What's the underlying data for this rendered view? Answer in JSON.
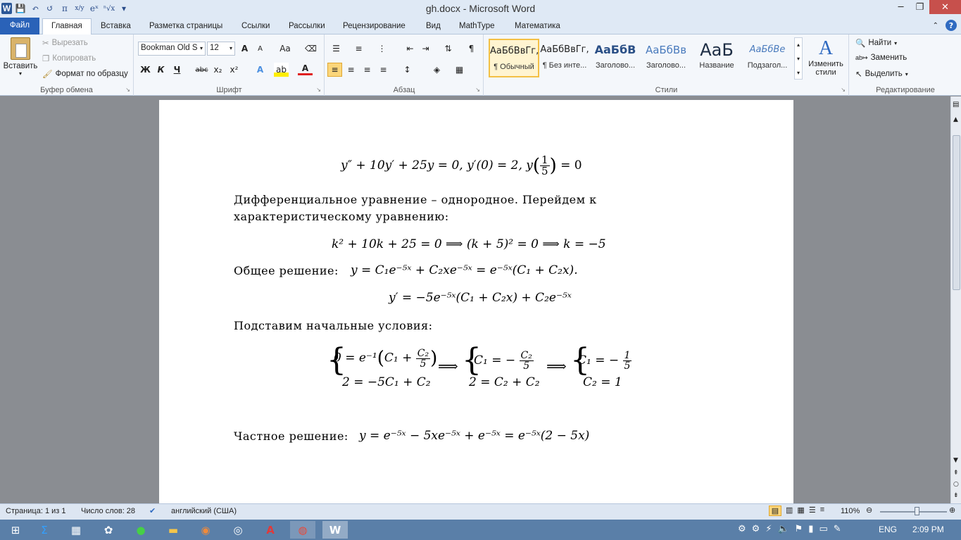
{
  "window": {
    "title": "gh.docx - Microsoft Word",
    "minimize": "─",
    "maximize": "❐",
    "close": "✕"
  },
  "qat": {
    "word_logo": "W",
    "save": "💾",
    "undo": "↶",
    "redo": "↺",
    "pi": "π",
    "frac": "x/y",
    "exp": "eˣ",
    "root": "ⁿ√x",
    "more": "▾"
  },
  "tabs": {
    "file": "Файл",
    "home": "Главная",
    "insert": "Вставка",
    "layout": "Разметка страницы",
    "refs": "Ссылки",
    "mailings": "Рассылки",
    "review": "Рецензирование",
    "view": "Вид",
    "mathtype": "MathType",
    "math": "Математика"
  },
  "clipboard": {
    "paste": "Вставить",
    "cut": "Вырезать",
    "copy": "Копировать",
    "format_painter": "Формат по образцу",
    "label": "Буфер обмена"
  },
  "font": {
    "name": "Bookman Old S",
    "size": "12",
    "grow": "A",
    "shrink": "A",
    "case": "Aa",
    "bold": "Ж",
    "italic": "К",
    "underline": "Ч",
    "strike": "abc",
    "sub": "x₂",
    "sup": "x²",
    "label": "Шрифт"
  },
  "paragraph": {
    "label": "Абзац",
    "pilcrow": "¶"
  },
  "styles": {
    "label": "Стили",
    "items": [
      {
        "preview": "АаБбВвГг,",
        "name": "¶ Обычный"
      },
      {
        "preview": "АаБбВвГг,",
        "name": "¶ Без инте..."
      },
      {
        "preview": "АаБбВ",
        "name": "Заголово..."
      },
      {
        "preview": "АаБбВв",
        "name": "Заголово..."
      },
      {
        "preview": "АаБ",
        "name": "Название"
      },
      {
        "preview": "АаБбВе",
        "name": "Подзагол..."
      }
    ],
    "change": "Изменить стили"
  },
  "editing": {
    "find": "Найти",
    "replace": "Заменить",
    "select": "Выделить",
    "label": "Редактирование"
  },
  "document": {
    "eq1": "y″ + 10y′ + 25y = 0,      y′(0) = 2,      y",
    "eq1_frac_num": "1",
    "eq1_frac_den": "5",
    "eq1_tail": "= 0",
    "p1_line1": "Дифференциальное уравнение – однородное. Перейдем к",
    "p1_line2": "характеристическому уравнению:",
    "eq2": "k² + 10k + 25 = 0  ⟹  (k + 5)² = 0    ⟹    k = −5",
    "p2_label": "Общее решение:",
    "p2_math": "y = C₁e⁻⁵ˣ + C₂xe⁻⁵ˣ = e⁻⁵ˣ(C₁ + C₂x).",
    "eq3": "y′ = −5e⁻⁵ˣ(C₁ + C₂x) + C₂e⁻⁵ˣ",
    "p3": "Подставим начальные условия:",
    "sys1_a": "0 = e⁻¹",
    "sys1_b": "C₁ +",
    "sys1_num": "C₂",
    "sys1_den": "5",
    "sys1_c": "2 = −5C₁ + C₂",
    "sys2_a": "C₁ = −",
    "sys2_num": "C₂",
    "sys2_den": "5",
    "sys2_b": "2 = C₂ + C₂",
    "sys3_a": "C₁ = −",
    "sys3_num": "1",
    "sys3_den": "5",
    "sys3_b": "C₂ = 1",
    "implies": "⟹",
    "p4_label": "Частное решение:",
    "p4_math": "y = e⁻⁵ˣ − 5xe⁻⁵ˣ + e⁻⁵ˣ = e⁻⁵ˣ(2 − 5x)"
  },
  "status": {
    "page": "Страница: 1 из 1",
    "words": "Число слов: 28",
    "lang": "английский (США)",
    "zoom": "110%",
    "zoom_level": 0.55
  },
  "taskbar": {
    "lang": "ENG",
    "time": "2:09 PM"
  }
}
